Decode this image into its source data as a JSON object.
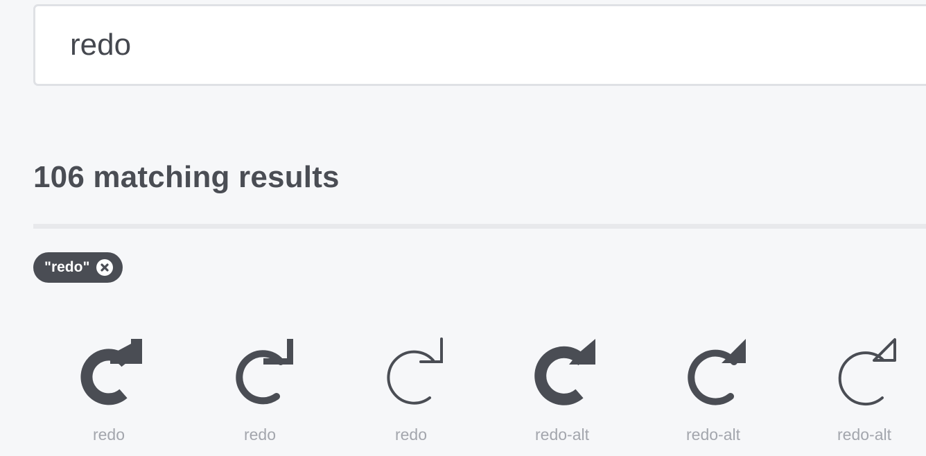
{
  "search": {
    "value": "redo",
    "placeholder": ""
  },
  "results": {
    "heading": "106 matching results"
  },
  "filters": [
    {
      "label": "\"redo\"",
      "remove_icon": "close-circle-icon"
    }
  ],
  "icons": [
    {
      "name": "redo",
      "style": "solid"
    },
    {
      "name": "redo",
      "style": "regular"
    },
    {
      "name": "redo",
      "style": "light"
    },
    {
      "name": "redo-alt",
      "style": "solid"
    },
    {
      "name": "redo-alt",
      "style": "regular"
    },
    {
      "name": "redo-alt",
      "style": "light"
    }
  ],
  "colors": {
    "background": "#f6f7f9",
    "text": "#4a4d54",
    "label": "#a3a6ad",
    "chip": "#4a4d54"
  }
}
